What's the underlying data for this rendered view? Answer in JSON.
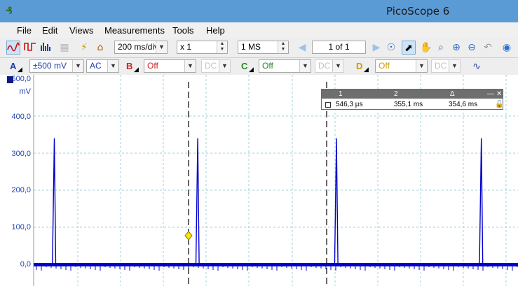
{
  "window": {
    "title": "PicoScope 6",
    "logo": "₰"
  },
  "menu": {
    "items": [
      "File",
      "Edit",
      "Views",
      "Measurements",
      "Tools",
      "Help"
    ]
  },
  "toolbar": {
    "timebase": "200 ms/div",
    "zoom": "x 1",
    "samples": "1 MS",
    "buffer_position": "1 of 1"
  },
  "channels": {
    "a": {
      "name": "A",
      "range": "±500 mV",
      "coupling": "AC",
      "color": "#1c3fae"
    },
    "b": {
      "name": "B",
      "range": "Off",
      "coupling": "DC",
      "color": "#cc2222"
    },
    "c": {
      "name": "C",
      "range": "Off",
      "coupling": "DC",
      "color": "#228822"
    },
    "d": {
      "name": "D",
      "range": "Off",
      "coupling": "DC",
      "color": "#cc9a00"
    }
  },
  "yaxis": {
    "unit": "mV",
    "ticks": [
      "500,0",
      "400,0",
      "300,0",
      "200,0",
      "100,0",
      "0,0"
    ]
  },
  "rulers": {
    "columns": [
      "1",
      "2",
      "Δ"
    ],
    "values": [
      "546,3 µs",
      "355,1 ms",
      "354,6 ms"
    ]
  },
  "chart_data": {
    "type": "line",
    "title": "",
    "xlabel": "",
    "ylabel": "mV",
    "ylim": [
      0,
      500
    ],
    "grid": true,
    "series": [
      {
        "values_note_free": true,
        "points": [
          {
            "x": 0.0,
            "y": 0
          },
          {
            "x": 0.04,
            "y": 0
          },
          {
            "x": 0.044,
            "y": 340
          },
          {
            "x": 0.047,
            "y": 0
          },
          {
            "x": 0.345,
            "y": 0
          },
          {
            "x": 0.349,
            "y": 340
          },
          {
            "x": 0.352,
            "y": 0
          },
          {
            "x": 0.64,
            "y": 0
          },
          {
            "x": 0.644,
            "y": 340
          },
          {
            "x": 0.647,
            "y": 0
          },
          {
            "x": 0.948,
            "y": 0
          },
          {
            "x": 0.952,
            "y": 340
          },
          {
            "x": 0.955,
            "y": 0
          },
          {
            "x": 1.03,
            "y": 0
          }
        ]
      }
    ]
  },
  "colors": {
    "trace": "#0000cc",
    "grid": "#9fd1de",
    "titlebar": "#5b9bd5",
    "ruler": "#000000"
  },
  "icons": [
    "scope-mode-icon",
    "persistence-icon",
    "spectrum-icon",
    "trigger-icon",
    "home-icon",
    "prev-icon",
    "next-icon",
    "select-icon",
    "hand-icon",
    "zoom-icon",
    "zoom-in-icon",
    "zoom-out-icon",
    "undo-icon",
    "zoom-fit-icon",
    "auto-setup-icon"
  ]
}
